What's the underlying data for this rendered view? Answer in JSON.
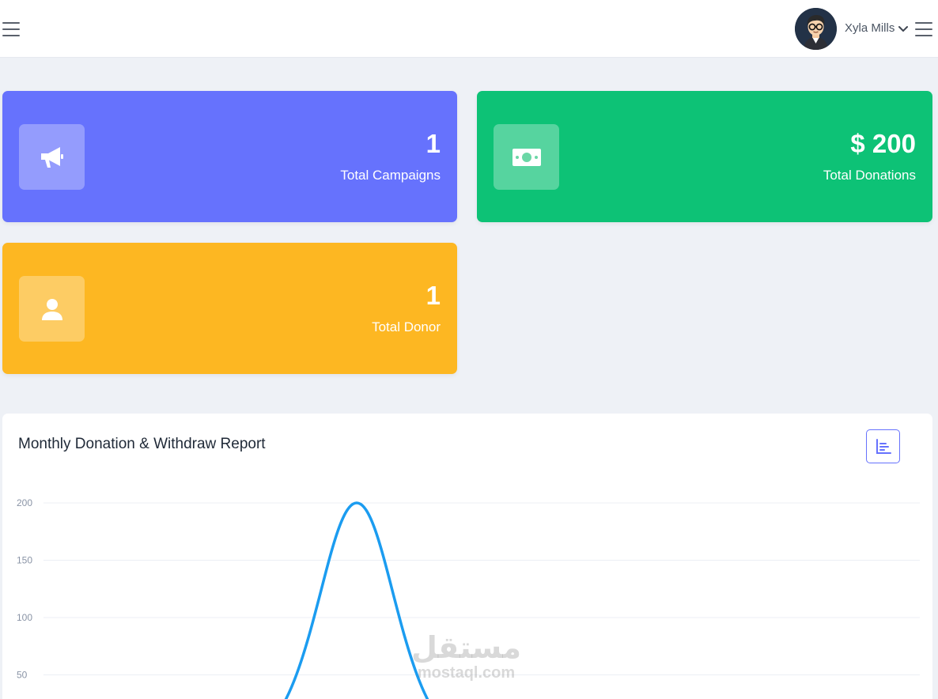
{
  "header": {
    "user_name": "Xyla Mills"
  },
  "icons": {
    "menu_left": "hamburger-icon",
    "menu_right": "hamburger-icon",
    "user_dropdown": "chevron-down-icon",
    "campaigns": "megaphone-icon",
    "donations": "money-bill-icon",
    "donor": "user-icon",
    "chart_toggle": "bar-chart-icon"
  },
  "stats": [
    {
      "value": "1",
      "label": "Total Campaigns",
      "color": "#6672fd"
    },
    {
      "value": "$ 200",
      "label": "Total Donations",
      "color": "#0dc276"
    },
    {
      "value": "1",
      "label": "Total Donor",
      "color": "#fdb722"
    }
  ],
  "report": {
    "title": "Monthly Donation & Withdraw Report"
  },
  "chart_data": {
    "type": "line",
    "title": "Monthly Donation & Withdraw Report",
    "xlabel": "",
    "ylabel": "",
    "y_ticks": [
      200,
      150,
      100,
      50
    ],
    "ylim": [
      0,
      200
    ],
    "grid": true,
    "series": [
      {
        "color": "#1b9cf0",
        "points": [
          {
            "x": 0.0,
            "y": 0
          },
          {
            "x": 1.0,
            "y": 200
          },
          {
            "x": 2.0,
            "y": 0
          }
        ]
      }
    ]
  },
  "watermark": {
    "arabic": "مستقل",
    "latin": "mostaql.com"
  }
}
